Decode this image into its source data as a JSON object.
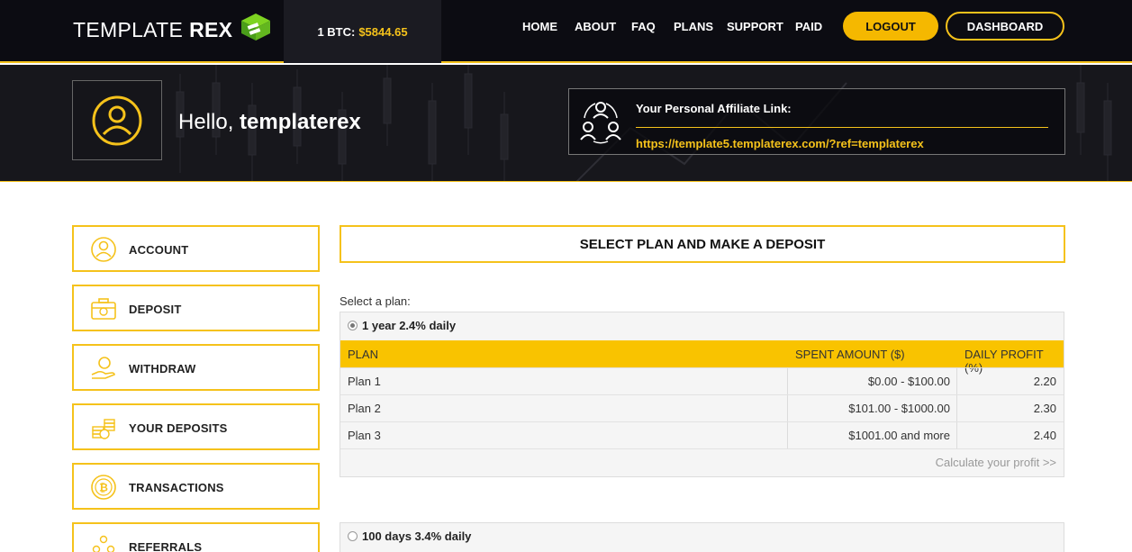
{
  "header": {
    "logo_regular": "TEMPLATE",
    "logo_bold": "REX",
    "btc_label": "1 BTC:",
    "btc_value": "$5844.65",
    "nav": [
      "HOME",
      "ABOUT",
      "FAQ",
      "PLANS",
      "SUPPORT",
      "PAID"
    ],
    "logout_label": "LOGOUT",
    "dashboard_label": "DASHBOARD"
  },
  "hero": {
    "greeting": "Hello,",
    "username": "templaterex",
    "affiliate_title": "Your Personal Affiliate Link:",
    "affiliate_link": "https://template5.templaterex.com/?ref=templaterex"
  },
  "sidebar": {
    "items": [
      {
        "label": "ACCOUNT",
        "icon": "user-circle-icon"
      },
      {
        "label": "DEPOSIT",
        "icon": "briefcase-coin-icon"
      },
      {
        "label": "WITHDRAW",
        "icon": "hand-coin-icon"
      },
      {
        "label": "YOUR DEPOSITS",
        "icon": "coin-stack-icon"
      },
      {
        "label": "TRANSACTIONS",
        "icon": "bitcoin-icon"
      },
      {
        "label": "REFERRALS",
        "icon": "referrals-icon"
      }
    ]
  },
  "main": {
    "title": "SELECT PLAN AND MAKE A DEPOSIT",
    "select_label": "Select a plan:",
    "plans": [
      {
        "name": "1 year 2.4% daily",
        "selected": true,
        "columns": [
          "PLAN",
          "SPENT AMOUNT ($)",
          "DAILY PROFIT (%)"
        ],
        "rows": [
          [
            "Plan 1",
            "$0.00 - $100.00",
            "2.20"
          ],
          [
            "Plan 2",
            "$101.00 - $1000.00",
            "2.30"
          ],
          [
            "Plan 3",
            "$1001.00 and more",
            "2.40"
          ]
        ],
        "calc_label": "Calculate your profit >>"
      },
      {
        "name": "100 days 3.4% daily",
        "selected": false
      }
    ]
  },
  "colors": {
    "accent": "#f5c21b",
    "dark_bg": "#0c0c12",
    "table_header": "#f9c300"
  }
}
